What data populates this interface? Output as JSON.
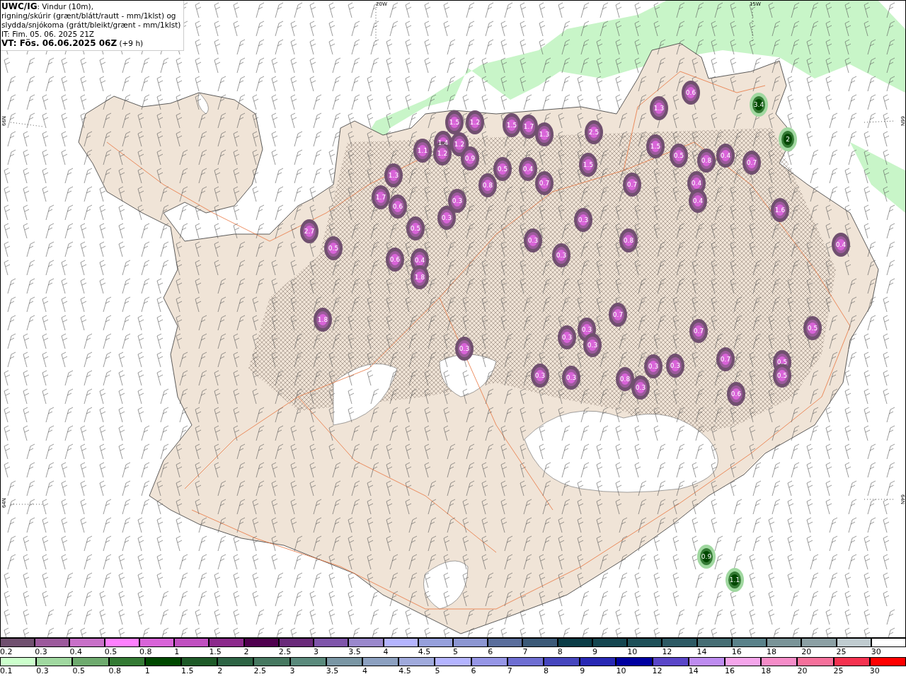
{
  "header": {
    "lines": [
      "**UWC/IG**: Vindur (10m),",
      "rigning/skúrir (grænt/blátt/rautt - mm/1klst) og",
      "slydda/snjókoma (grátt/bleikt/grænt - mm/1klst)",
      "IT: Fim. 05. 06. 2025 21Z",
      "**VT: Fös. 06.06.2025 06Z** (+9 h)"
    ]
  },
  "map": {
    "axis_labels": [
      {
        "text": "20W",
        "kind": "lon"
      },
      {
        "text": "15W",
        "kind": "lon"
      },
      {
        "text": "66N",
        "kind": "lat"
      },
      {
        "text": "64N",
        "kind": "lat"
      },
      {
        "text": "66N",
        "kind": "lat"
      },
      {
        "text": "64N",
        "kind": "lat"
      }
    ],
    "cells": [
      {
        "label": "1.1",
        "kind": "snow"
      },
      {
        "label": "1.4",
        "kind": "snow"
      },
      {
        "label": "1.2",
        "kind": "snow"
      },
      {
        "label": "1.5",
        "kind": "snow"
      },
      {
        "label": "1.2",
        "kind": "snow"
      },
      {
        "label": "1.2",
        "kind": "snow"
      },
      {
        "label": "0.9",
        "kind": "snow"
      },
      {
        "label": "1.5",
        "kind": "snow"
      },
      {
        "label": "1.7",
        "kind": "snow"
      },
      {
        "label": "1.3",
        "kind": "snow"
      },
      {
        "label": "0.8",
        "kind": "snow"
      },
      {
        "label": "0.5",
        "kind": "snow"
      },
      {
        "label": "0.4",
        "kind": "snow"
      },
      {
        "label": "0.7",
        "kind": "snow"
      },
      {
        "label": "2.5",
        "kind": "snow"
      },
      {
        "label": "1.5",
        "kind": "snow"
      },
      {
        "label": "1.3",
        "kind": "snow"
      },
      {
        "label": "0.6",
        "kind": "snow"
      },
      {
        "label": "1.5",
        "kind": "snow"
      },
      {
        "label": "0.5",
        "kind": "snow"
      },
      {
        "label": "0.8",
        "kind": "snow"
      },
      {
        "label": "0.4",
        "kind": "snow"
      },
      {
        "label": "0.7",
        "kind": "snow"
      },
      {
        "label": "0.4",
        "kind": "snow"
      },
      {
        "label": "0.4",
        "kind": "snow"
      },
      {
        "label": "0.7",
        "kind": "snow"
      },
      {
        "label": "1.6",
        "kind": "snow"
      },
      {
        "label": "0.4",
        "kind": "snow"
      },
      {
        "label": "0.8",
        "kind": "snow"
      },
      {
        "label": "0.7",
        "kind": "snow"
      },
      {
        "label": "0.3",
        "kind": "snow"
      },
      {
        "label": "0.3",
        "kind": "snow"
      },
      {
        "label": "0.3",
        "kind": "snow"
      },
      {
        "label": "0.3",
        "kind": "snow"
      },
      {
        "label": "0.3",
        "kind": "snow"
      },
      {
        "label": "0.3",
        "kind": "snow"
      },
      {
        "label": "0.3",
        "kind": "snow"
      },
      {
        "label": "0.3",
        "kind": "snow"
      },
      {
        "label": "0.3",
        "kind": "snow"
      },
      {
        "label": "0.3",
        "kind": "snow"
      },
      {
        "label": "0.3",
        "kind": "snow"
      },
      {
        "label": "0.8",
        "kind": "snow"
      },
      {
        "label": "0.3",
        "kind": "snow"
      },
      {
        "label": "0.3",
        "kind": "snow"
      },
      {
        "label": "0.3",
        "kind": "snow"
      },
      {
        "label": "0.7",
        "kind": "snow"
      },
      {
        "label": "0.7",
        "kind": "snow"
      },
      {
        "label": "0.6",
        "kind": "snow"
      },
      {
        "label": "0.5",
        "kind": "snow"
      },
      {
        "label": "0.5",
        "kind": "snow"
      },
      {
        "label": "0.5",
        "kind": "snow"
      },
      {
        "label": "2.7",
        "kind": "snow"
      },
      {
        "label": "0.5",
        "kind": "snow"
      },
      {
        "label": "1.8",
        "kind": "snow"
      },
      {
        "label": "1.3",
        "kind": "snow"
      },
      {
        "label": "1.7",
        "kind": "snow"
      },
      {
        "label": "0.6",
        "kind": "snow"
      },
      {
        "label": "0.5",
        "kind": "snow"
      },
      {
        "label": "0.6",
        "kind": "snow"
      },
      {
        "label": "0.4",
        "kind": "snow"
      },
      {
        "label": "1.8",
        "kind": "snow"
      },
      {
        "label": "2",
        "kind": "rain"
      },
      {
        "label": "3.4",
        "kind": "rain"
      },
      {
        "label": "0.9",
        "kind": "rain"
      },
      {
        "label": "1.1",
        "kind": "rain"
      }
    ]
  },
  "legends": [
    {
      "steps": [
        {
          "label": "0.2",
          "color": "#70506f"
        },
        {
          "label": "0.3",
          "color": "#9c5a9c"
        },
        {
          "label": "0.4",
          "color": "#c870c8"
        },
        {
          "label": "0.5",
          "color": "#ff80ff"
        },
        {
          "label": "0.8",
          "color": "#d864d8"
        },
        {
          "label": "1",
          "color": "#c050c0"
        },
        {
          "label": "1.5",
          "color": "#8c2a8c"
        },
        {
          "label": "2",
          "color": "#50004f"
        },
        {
          "label": "2.5",
          "color": "#6a2a7a"
        },
        {
          "label": "3",
          "color": "#7f55aa"
        },
        {
          "label": "3.5",
          "color": "#9a88cc"
        },
        {
          "label": "4",
          "color": "#b4b4ff"
        },
        {
          "label": "4.5",
          "color": "#96a0dc"
        },
        {
          "label": "5",
          "color": "#8c96d2"
        },
        {
          "label": "6",
          "color": "#5a6e9c"
        },
        {
          "label": "7",
          "color": "#3c5a78"
        },
        {
          "label": "8",
          "color": "#0a3c46"
        },
        {
          "label": "9",
          "color": "#144650"
        },
        {
          "label": "10",
          "color": "#1e5058"
        },
        {
          "label": "12",
          "color": "#2d5a64"
        },
        {
          "label": "14",
          "color": "#466e74"
        },
        {
          "label": "16",
          "color": "#5a828a"
        },
        {
          "label": "18",
          "color": "#7a9498"
        },
        {
          "label": "20",
          "color": "#8ca0a4"
        },
        {
          "label": "25",
          "color": "#c0ccd0"
        },
        {
          "label": "30",
          "color": "#ffffff"
        }
      ]
    },
    {
      "steps": [
        {
          "label": "0.1",
          "color": "#ccffcc"
        },
        {
          "label": "0.3",
          "color": "#a0d8a0"
        },
        {
          "label": "0.5",
          "color": "#6eaa6e"
        },
        {
          "label": "0.8",
          "color": "#347a34"
        },
        {
          "label": "1",
          "color": "#004800"
        },
        {
          "label": "1.5",
          "color": "#1e5a28"
        },
        {
          "label": "2",
          "color": "#2d6444"
        },
        {
          "label": "2.5",
          "color": "#467860"
        },
        {
          "label": "3",
          "color": "#5a8a7c"
        },
        {
          "label": "3.5",
          "color": "#7a96a4"
        },
        {
          "label": "4",
          "color": "#8ca0c0"
        },
        {
          "label": "4.5",
          "color": "#a0aadc"
        },
        {
          "label": "5",
          "color": "#b4b4ff"
        },
        {
          "label": "6",
          "color": "#9696e6"
        },
        {
          "label": "7",
          "color": "#6e6ed2"
        },
        {
          "label": "8",
          "color": "#4646be"
        },
        {
          "label": "9",
          "color": "#2828b4"
        },
        {
          "label": "10",
          "color": "#0000a0"
        },
        {
          "label": "12",
          "color": "#5a46c8"
        },
        {
          "label": "14",
          "color": "#be8cf0"
        },
        {
          "label": "16",
          "color": "#f5a5eb"
        },
        {
          "label": "18",
          "color": "#f58cc8"
        },
        {
          "label": "20",
          "color": "#f5709b"
        },
        {
          "label": "25",
          "color": "#f53250"
        },
        {
          "label": "30",
          "color": "#ff0000"
        }
      ]
    }
  ]
}
